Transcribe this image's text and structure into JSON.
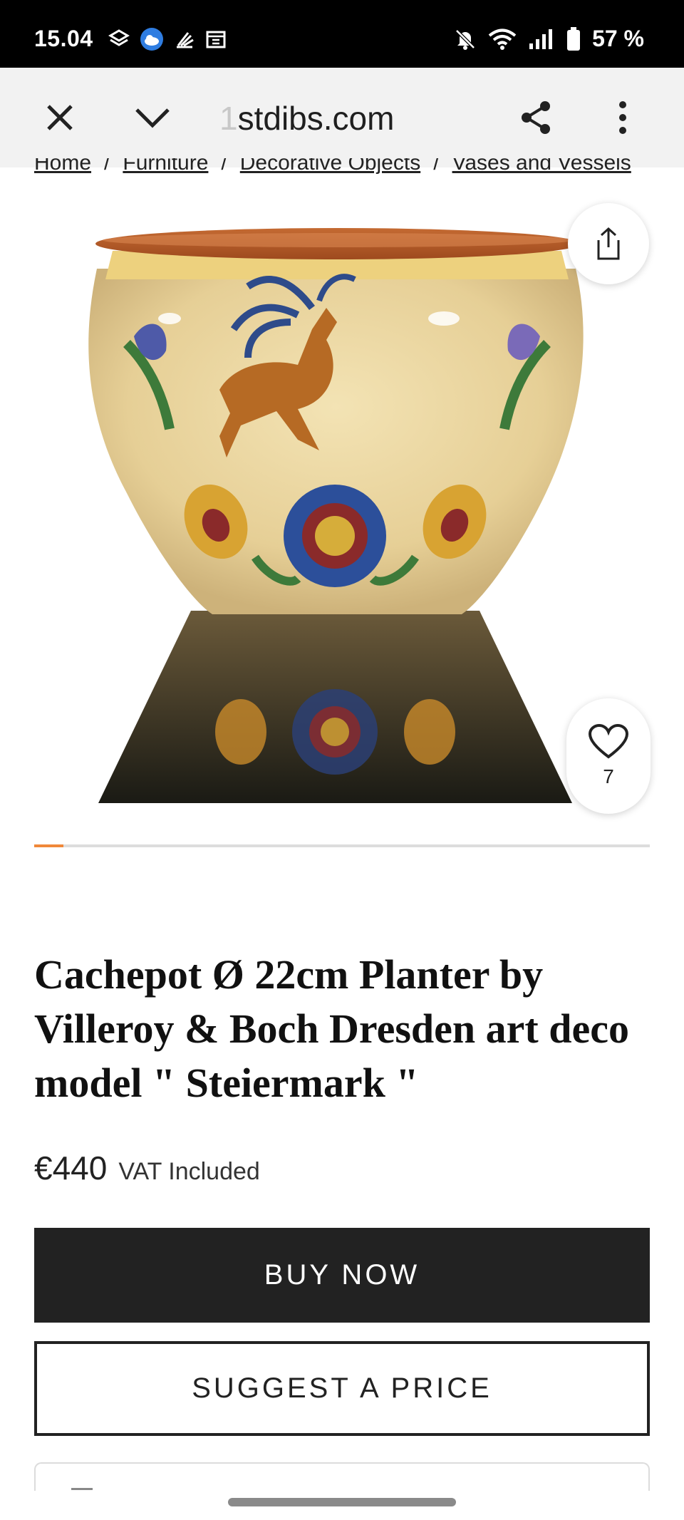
{
  "status_bar": {
    "time": "15.04",
    "battery_text": "57 %",
    "icons_left": [
      "layers-icon",
      "weather-cloud-icon",
      "bird-icon",
      "calendar-icon"
    ],
    "icons_right": [
      "mute-bell-icon",
      "wifi-icon",
      "signal-icon",
      "battery-icon"
    ]
  },
  "browser": {
    "url_prefix": "1",
    "url": "stdibs.com",
    "close_icon": "close-icon",
    "collapse_icon": "chevron-down-icon",
    "share_icon": "share-icon",
    "menu_icon": "more-vertical-icon"
  },
  "breadcrumb": [
    "Home",
    "Furniture",
    "Decorative Objects",
    "Vases and Vessels"
  ],
  "product": {
    "favorite_count": "7",
    "carousel_progress": 0.047,
    "title": "Cachepot Ø 22cm Planter by Villeroy & Boch Dresden art deco model \" Steiermark \"",
    "price": "€440",
    "vat": "VAT Included"
  },
  "actions": {
    "buy_now": "BUY NOW",
    "suggest_price": "SUGGEST A PRICE"
  },
  "colors": {
    "accent_progress": "#f0883a",
    "button_dark": "#222222"
  }
}
